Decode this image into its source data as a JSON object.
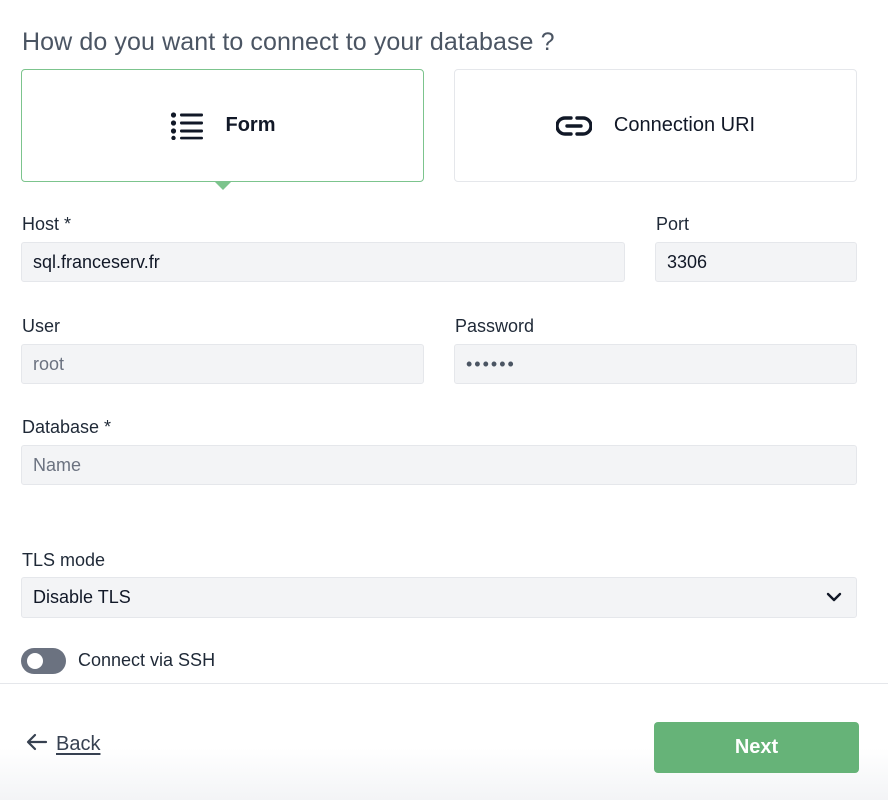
{
  "heading": "How do you want to connect to your database ?",
  "methods": {
    "form": {
      "label": "Form",
      "icon": "list-icon",
      "selected": true
    },
    "uri": {
      "label": "Connection URI",
      "icon": "link-icon",
      "selected": false
    }
  },
  "fields": {
    "host": {
      "label": "Host *",
      "value": "sql.franceserv.fr"
    },
    "port": {
      "label": "Port",
      "value": "3306"
    },
    "user": {
      "label": "User",
      "value": "root"
    },
    "password": {
      "label": "Password",
      "value": "••••••"
    },
    "database": {
      "label": "Database *",
      "value": "",
      "placeholder": "Name"
    }
  },
  "tls": {
    "label": "TLS mode",
    "value": "Disable TLS",
    "icon": "chevron-down-icon"
  },
  "ssh": {
    "label": "Connect via SSH",
    "enabled": false
  },
  "footer": {
    "back_label": "Back",
    "back_icon": "arrow-left-icon",
    "next_label": "Next"
  },
  "colors": {
    "accent": "#66b378",
    "selected_border": "#7cc48d",
    "toggle_off": "#6b7280"
  }
}
